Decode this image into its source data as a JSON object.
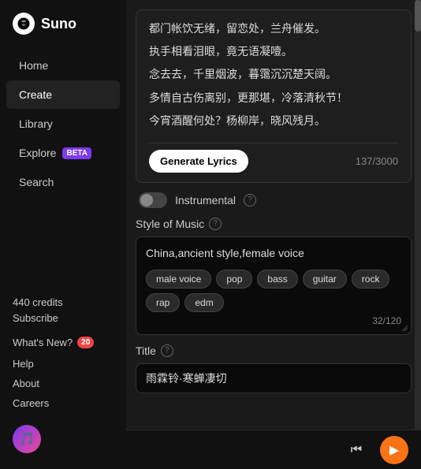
{
  "logo": {
    "text": "Suno"
  },
  "sidebar": {
    "nav_items": [
      {
        "id": "home",
        "label": "Home",
        "active": false
      },
      {
        "id": "create",
        "label": "Create",
        "active": true
      },
      {
        "id": "library",
        "label": "Library",
        "active": false
      },
      {
        "id": "explore",
        "label": "Explore",
        "active": false,
        "badge": "BETA"
      },
      {
        "id": "search",
        "label": "Search",
        "active": false
      }
    ],
    "credits": {
      "amount": "440 credits",
      "subscribe": "Subscribe"
    },
    "whats_new": {
      "label": "What's New?",
      "count": "20"
    },
    "links": [
      "Help",
      "About",
      "Careers"
    ]
  },
  "lyrics": {
    "lines": [
      "都门帐饮无绪，留恋处，兰舟催发。",
      "执手相看泪眼，竟无语凝噎。",
      "念去去，千里烟波，暮霭沉沉楚天阔。",
      "多情自古伤离别，更那堪，冷落清秋节！",
      "今宵酒醒何处？杨柳岸，晓风残月。"
    ],
    "generate_btn": "Generate Lyrics",
    "char_count": "137/3000"
  },
  "instrumental": {
    "label": "Instrumental"
  },
  "style_of_music": {
    "label": "Style of Music",
    "value": "China,ancient style,female voice",
    "tags": [
      "male voice",
      "pop",
      "bass",
      "guitar",
      "rock",
      "rap",
      "edm"
    ],
    "char_count": "32/120"
  },
  "title": {
    "label": "Title",
    "value": "雨霖铃·寒蝉凄切"
  },
  "player": {
    "skip_label": "⏮",
    "play_label": "▶"
  }
}
